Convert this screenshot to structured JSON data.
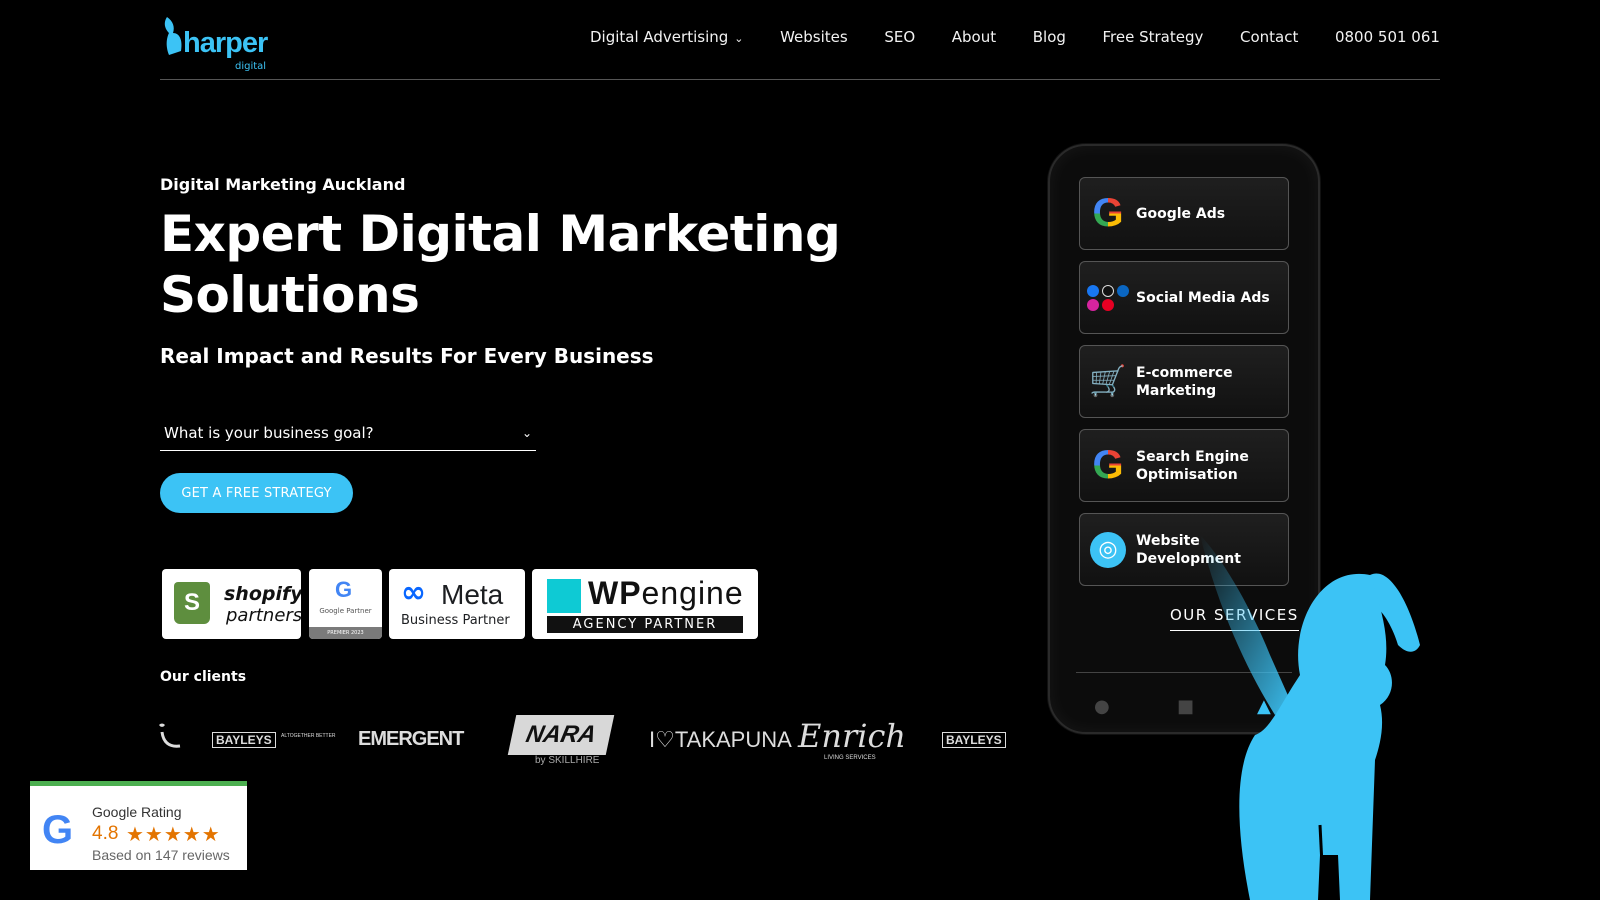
{
  "brand": {
    "name": "harper",
    "sub": "digital"
  },
  "nav": {
    "items": [
      "Digital Advertising",
      "Websites",
      "SEO",
      "About",
      "Blog",
      "Free Strategy",
      "Contact",
      "0800 501 061"
    ],
    "dropdown_icon": "chevron-down-icon"
  },
  "hero": {
    "kicker": "Digital Marketing Auckland",
    "title": "Expert Digital Marketing Solutions",
    "subtitle": "Real Impact and Results For Every Business",
    "goal_select": "What is your business goal?",
    "cta": "GET A FREE STRATEGY"
  },
  "partners": {
    "shopify": {
      "line1": "shopify",
      "line2": "partners"
    },
    "google": {
      "line1": "Google Partner",
      "line2": "PREMIER 2023"
    },
    "meta": {
      "line1": "Meta",
      "line2": "Business Partner"
    },
    "wpengine": {
      "line1a": "WP",
      "line1b": "engine",
      "line2": "AGENCY PARTNER"
    }
  },
  "clients": {
    "label": "Our clients",
    "logos": [
      "BAYLEYS",
      "ALTOGETHER BETTER",
      "EMERGENT",
      "NARA",
      "by SKILLHIRE",
      "I♡TAKAPUNA",
      "Enrich",
      "LIVING SERVICES",
      "BAYLEYS"
    ]
  },
  "rating": {
    "title": "Google Rating",
    "score": "4.8",
    "stars": "★★★★★",
    "reviews": "Based on 147 reviews"
  },
  "services": {
    "items": [
      "Google Ads",
      "Social Media Ads",
      "E-commerce Marketing",
      "Search Engine Optimisation",
      "Website Development"
    ],
    "link": "OUR SERVICES"
  },
  "colors": {
    "accent": "#3cc3f5",
    "background": "#000000",
    "rating_bar": "#4caf50",
    "stars": "#e37400"
  }
}
